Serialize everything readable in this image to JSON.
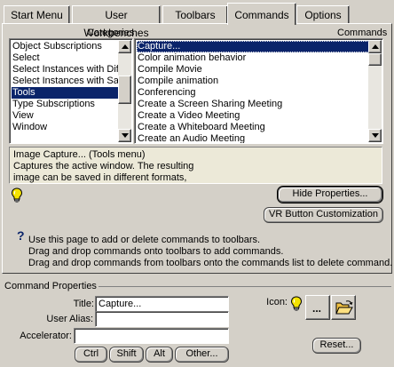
{
  "tabs": [
    {
      "label": "Start Menu",
      "active": false
    },
    {
      "label": "User Workbenches",
      "active": false
    },
    {
      "label": "Toolbars",
      "active": false
    },
    {
      "label": "Commands",
      "active": true
    },
    {
      "label": "Options",
      "active": false
    }
  ],
  "categories": {
    "header": "Categories",
    "items": [
      "Object Subscriptions",
      "Select",
      "Select Instances with Dif",
      "Select Instances with Sa",
      "Tools",
      "Type Subscriptions",
      "View",
      "Window"
    ],
    "selected": "Tools"
  },
  "commands": {
    "header": "Commands",
    "items": [
      "Capture...",
      "Color animation behavior",
      "Compile Movie",
      "Compile animation",
      "Conferencing",
      "Create a Screen Sharing Meeting",
      "Create a Video Meeting",
      "Create a Whiteboard Meeting",
      "Create an Audio Meeting"
    ],
    "selected": "Capture..."
  },
  "description": {
    "lines": [
      "Image Capture... (Tools menu)",
      "Captures the active window. The resulting",
      "image can be saved in different formats,"
    ]
  },
  "buttons": {
    "hide_properties": "Hide Properties...",
    "vr_customization": "VR Button Customization",
    "icon_browse": "...",
    "reset": "Reset...",
    "ctrl": "Ctrl",
    "shift": "Shift",
    "alt": "Alt",
    "other": "Other..."
  },
  "info": {
    "line1": "Use this page to add or delete commands to toolbars.",
    "line2": "Drag and drop commands onto toolbars to add commands.",
    "line3": "Drag and drop commands from toolbars onto the commands list to delete command."
  },
  "properties": {
    "group_title": "Command Properties",
    "title_label": "Title:",
    "title_value": "Capture...",
    "alias_label": "User Alias:",
    "alias_value": "",
    "accelerator_label": "Accelerator:",
    "accelerator_value": "",
    "icon_label": "Icon:"
  },
  "icons": {
    "tip": "lightbulb-icon",
    "info": "question-mark-icon",
    "command_icon": "lightbulb-icon",
    "folder": "open-folder-icon"
  },
  "colors": {
    "selection": "#0a246a",
    "dialog_bg": "#d4d0c8",
    "description_bg": "#ece9d8",
    "bulb": "#f5e300"
  }
}
